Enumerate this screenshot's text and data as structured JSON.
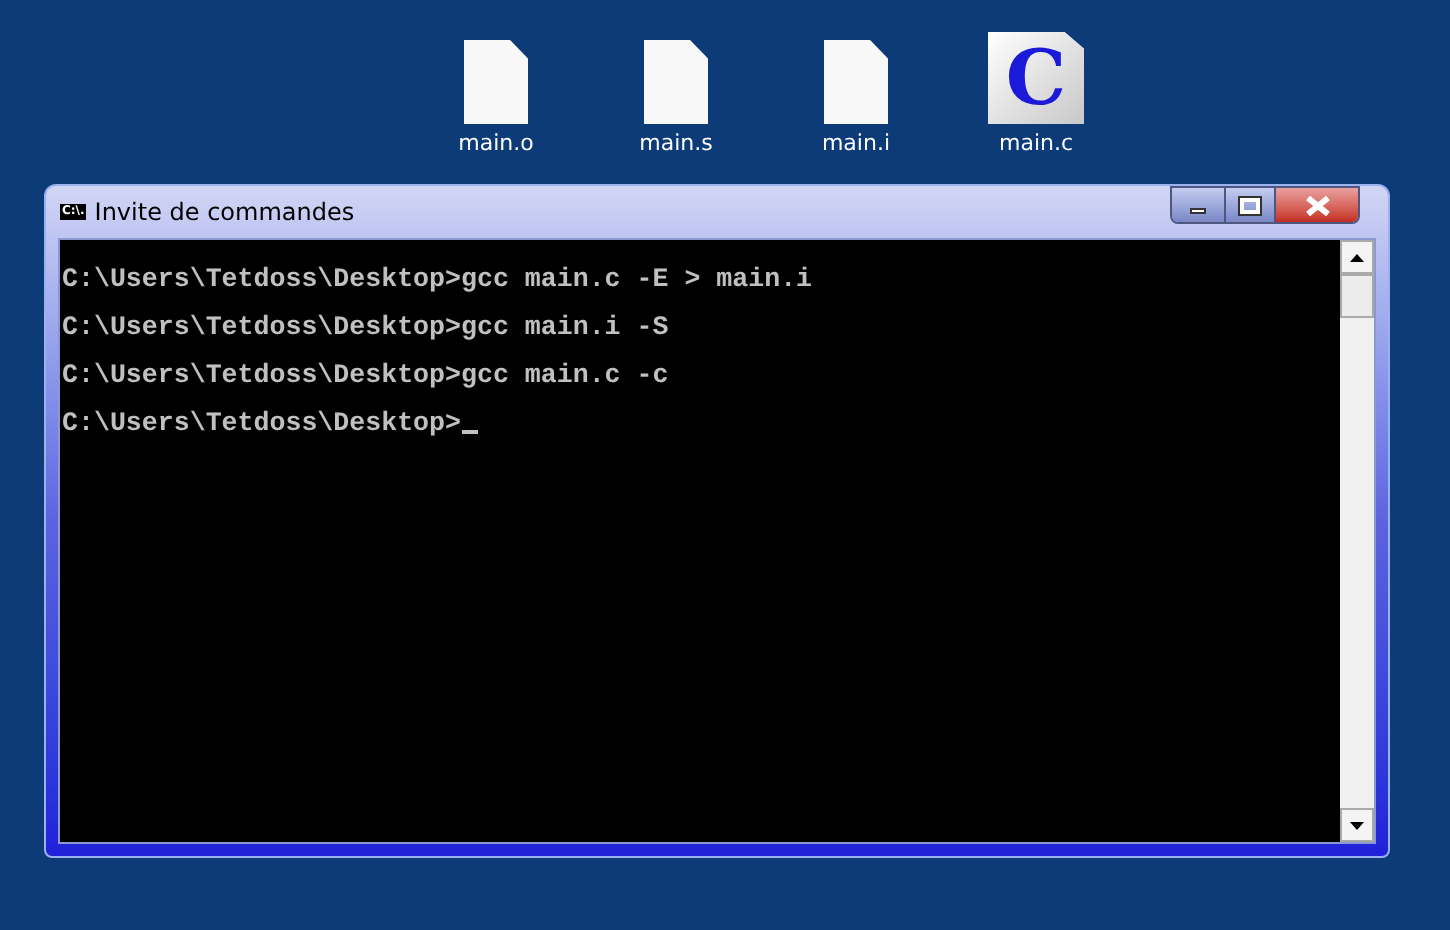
{
  "desktop_icons": [
    {
      "label": "main.o",
      "kind": "blank"
    },
    {
      "label": "main.s",
      "kind": "blank"
    },
    {
      "label": "main.i",
      "kind": "blank"
    },
    {
      "label": "main.c",
      "kind": "c-source",
      "glyph": "C"
    }
  ],
  "window": {
    "title": "Invite de commandes",
    "icon_text": "C:\\."
  },
  "console": {
    "lines": [
      "C:\\Users\\Tetdoss\\Desktop>gcc main.c -E > main.i",
      "C:\\Users\\Tetdoss\\Desktop>gcc main.i -S",
      "C:\\Users\\Tetdoss\\Desktop>gcc main.c -c",
      "C:\\Users\\Tetdoss\\Desktop>"
    ],
    "cursor": true
  }
}
